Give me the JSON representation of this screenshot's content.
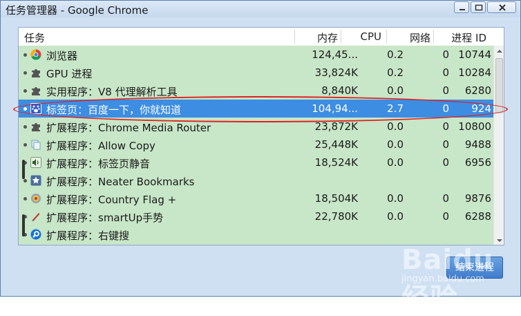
{
  "window": {
    "title": "任务管理器 - Google Chrome"
  },
  "columns": {
    "task": "任务",
    "memory": "内存",
    "cpu": "CPU",
    "network": "网络",
    "pid": "进程 ID"
  },
  "rows": [
    {
      "icon": "chrome-icon",
      "task": "浏览器",
      "memory": "124,45...",
      "cpu": "0.2",
      "network": "0",
      "pid": "10744"
    },
    {
      "icon": "puzzle-icon",
      "task": "GPU 进程",
      "memory": "33,824K",
      "cpu": "0.2",
      "network": "0",
      "pid": "10284"
    },
    {
      "icon": "puzzle-icon",
      "task": "实用程序：V8 代理解析工具",
      "memory": "8,840K",
      "cpu": "0.0",
      "network": "0",
      "pid": "6280"
    },
    {
      "icon": "baidu-paw-icon",
      "task": "标签页：百度一下，你就知道",
      "memory": "104,94...",
      "cpu": "2.7",
      "network": "0",
      "pid": "924",
      "selected": true
    },
    {
      "icon": "puzzle-icon",
      "task": "扩展程序：Chrome Media Router",
      "memory": "23,872K",
      "cpu": "0.0",
      "network": "0",
      "pid": "10800"
    },
    {
      "icon": "copy-icon",
      "task": "扩展程序：Allow Copy",
      "memory": "25,448K",
      "cpu": "0.0",
      "network": "0",
      "pid": "9488"
    },
    {
      "icon": "speaker-icon",
      "task": "扩展程序：标签页静音",
      "memory": "18,524K",
      "cpu": "0.0",
      "network": "0",
      "pid": "6956"
    },
    {
      "icon": "star-icon",
      "task": "扩展程序：Neater Bookmarks",
      "memory": "",
      "cpu": "",
      "network": "",
      "pid": ""
    },
    {
      "icon": "flag-gear-icon",
      "task": "扩展程序：Country Flag +",
      "memory": "18,504K",
      "cpu": "0.0",
      "network": "0",
      "pid": "9876"
    },
    {
      "icon": "pen-icon",
      "task": "扩展程序：smartUp手势",
      "memory": "22,780K",
      "cpu": "0.0",
      "network": "0",
      "pid": "6288"
    },
    {
      "icon": "search-icon",
      "task": "扩展程序：右键搜",
      "memory": "",
      "cpu": "",
      "network": "",
      "pid": ""
    }
  ],
  "end_process_button": "结束进程",
  "watermark": {
    "brand": "Baidu经验",
    "url": "jingyan.baidu.com"
  },
  "colors": {
    "row_bg": "#c8e6c8",
    "selected_bg": "#3d8de2",
    "annotation": "#dd2222"
  }
}
